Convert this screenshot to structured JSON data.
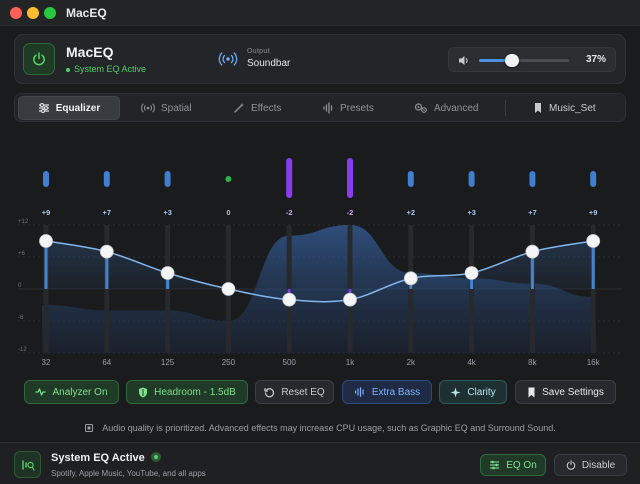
{
  "window": {
    "title": "MacEQ"
  },
  "header": {
    "app_name": "MacEQ",
    "status": "System EQ Active",
    "output_label": "Output",
    "output_value": "Soundbar",
    "volume_percent_text": "37%",
    "volume_level": 0.37
  },
  "tabs": [
    {
      "label": "Equalizer",
      "icon": "sliders-icon",
      "active": true
    },
    {
      "label": "Spatial",
      "icon": "spatial-icon",
      "active": false
    },
    {
      "label": "Effects",
      "icon": "wand-icon",
      "active": false
    },
    {
      "label": "Presets",
      "icon": "waveform-icon",
      "active": false
    },
    {
      "label": "Advanced",
      "icon": "gears-icon",
      "active": false
    },
    {
      "label": "Music_Set",
      "icon": "bookmark-icon",
      "active": false
    }
  ],
  "eq": {
    "gain_axis": {
      "ticks": [
        "+12",
        "+6",
        "0",
        "-6",
        "-12"
      ],
      "min": -12,
      "max": 12
    },
    "bands": [
      {
        "freq": "32",
        "gain": 9,
        "gain_label": "+9"
      },
      {
        "freq": "64",
        "gain": 7,
        "gain_label": "+7"
      },
      {
        "freq": "125",
        "gain": 3,
        "gain_label": "+3"
      },
      {
        "freq": "250",
        "gain": 0,
        "gain_label": "0"
      },
      {
        "freq": "500",
        "gain": -2,
        "gain_label": "-2"
      },
      {
        "freq": "1k",
        "gain": -2,
        "gain_label": "-2"
      },
      {
        "freq": "2k",
        "gain": 2,
        "gain_label": "+2"
      },
      {
        "freq": "4k",
        "gain": 3,
        "gain_label": "+3"
      },
      {
        "freq": "8k",
        "gain": 7,
        "gain_label": "+7"
      },
      {
        "freq": "16k",
        "gain": 9,
        "gain_label": "+9"
      }
    ],
    "colors": {
      "boost": "#4a90e2",
      "cut": "#8a3cf0",
      "neutral": "#2fb34a"
    }
  },
  "actions": {
    "analyzer": "Analyzer On",
    "headroom": "Headroom - 1.5dB",
    "reset": "Reset EQ",
    "extra_bass": "Extra Bass",
    "clarity": "Clarity",
    "save": "Save Settings"
  },
  "info": "Audio quality is prioritized. Advanced effects may increase CPU usage, such as Graphic EQ and Surround Sound.",
  "footer": {
    "title": "System EQ Active",
    "subtitle": "Spotify, Apple Music, YouTube, and all apps",
    "eq_on": "EQ On",
    "disable": "Disable"
  }
}
